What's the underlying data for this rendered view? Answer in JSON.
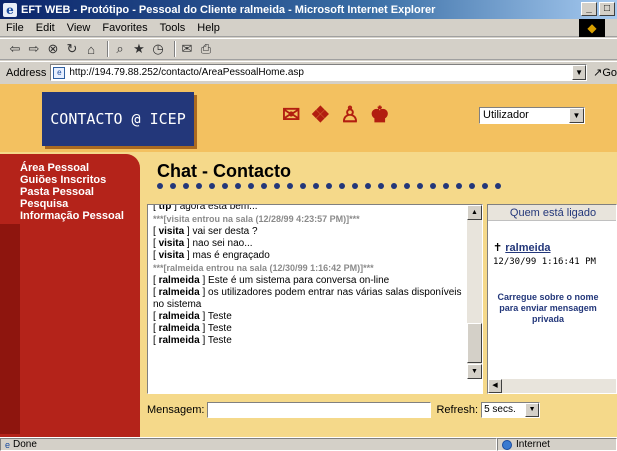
{
  "window": {
    "title": "EFT WEB - Protótipo - Pessoal do Cliente ralmeida - Microsoft Internet Explorer",
    "min_btn": "_",
    "max_btn": "□"
  },
  "menu": {
    "items": [
      "File",
      "Edit",
      "View",
      "Favorites",
      "Tools",
      "Help"
    ]
  },
  "address": {
    "label": "Address",
    "url": "http://194.79.88.252/contacto/AreaPessoalHome.asp",
    "go": "Go"
  },
  "header": {
    "logo": "CONTACTO @ ICEP",
    "user_select": "Utilizador"
  },
  "sidebar": {
    "items": [
      "Área Pessoal",
      "Guiões Inscritos",
      "Pasta Pessoal",
      "Pesquisa",
      "Informação Pessoal"
    ]
  },
  "chat": {
    "title": "Chat - Contacto",
    "lines": [
      {
        "user": "tfp",
        "text": "agora está bem..."
      },
      {
        "sys": "***[visita entrou na sala (12/28/99 4:23:57 PM)]***"
      },
      {
        "user": "visita",
        "text": "vai ser desta ?"
      },
      {
        "user": "visita",
        "text": "nao sei nao..."
      },
      {
        "user": "visita",
        "text": "mas é engraçado"
      },
      {
        "sys": "***[ralmeida entrou na sala (12/30/99 1:16:42 PM)]***"
      },
      {
        "user": "ralmeida",
        "text": "Este é um sistema para conversa on-line"
      },
      {
        "user": "ralmeida",
        "text": "os utilizadores podem entrar nas várias salas disponíveis no sistema"
      },
      {
        "user": "ralmeida",
        "text": "Teste"
      },
      {
        "user": "ralmeida",
        "text": "Teste"
      },
      {
        "user": "ralmeida",
        "text": "Teste"
      }
    ]
  },
  "users": {
    "heading": "Quem está ligado",
    "name": "ralmeida",
    "time": "12/30/99 1:16:41 PM",
    "hint": "Carregue sobre o nome para enviar mensagem privada"
  },
  "message": {
    "label": "Mensagem:",
    "value": "",
    "refresh_label": "Refresh:",
    "refresh_value": "5 secs."
  },
  "status": {
    "left": "Done",
    "zone": "Internet"
  }
}
